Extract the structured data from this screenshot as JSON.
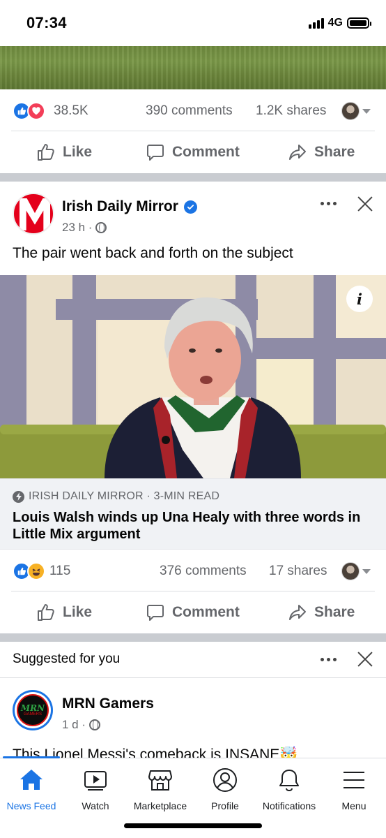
{
  "status_bar": {
    "time": "07:34",
    "network": "4G"
  },
  "post1": {
    "reaction_count": "38.5K",
    "comments": "390 comments",
    "shares": "1.2K shares",
    "actions": {
      "like": "Like",
      "comment": "Comment",
      "share": "Share"
    }
  },
  "post2": {
    "page_name": "Irish Daily Mirror",
    "time": "23 h ·",
    "text": "The pair went back and forth on the subject",
    "info_icon": "i",
    "link": {
      "source": "IRISH DAILY MIRROR · 3-MIN READ",
      "title": "Louis Walsh winds up Una Healy with three words in Little Mix argument"
    },
    "reaction_count": "115",
    "comments": "376 comments",
    "shares": "17 shares",
    "actions": {
      "like": "Like",
      "comment": "Comment",
      "share": "Share"
    }
  },
  "suggested": {
    "label": "Suggested for you",
    "page_name": "MRN Gamers",
    "time": "1 d ·",
    "avatar_text": "MRN",
    "avatar_sub": "GAMERS",
    "text": "This Lionel Messi's comeback is INSANE🤯"
  },
  "tab_bar": {
    "tabs": [
      {
        "label": "News Feed",
        "icon": "home-icon",
        "active": true
      },
      {
        "label": "Watch",
        "icon": "watch-icon",
        "active": false
      },
      {
        "label": "Marketplace",
        "icon": "marketplace-icon",
        "active": false
      },
      {
        "label": "Profile",
        "icon": "profile-icon",
        "active": false
      },
      {
        "label": "Notifications",
        "icon": "bell-icon",
        "active": false
      },
      {
        "label": "Menu",
        "icon": "menu-icon",
        "active": false
      }
    ]
  },
  "colors": {
    "accent": "#1b74e4",
    "text_secondary": "#65676b",
    "separator": "#c9ccd1"
  }
}
